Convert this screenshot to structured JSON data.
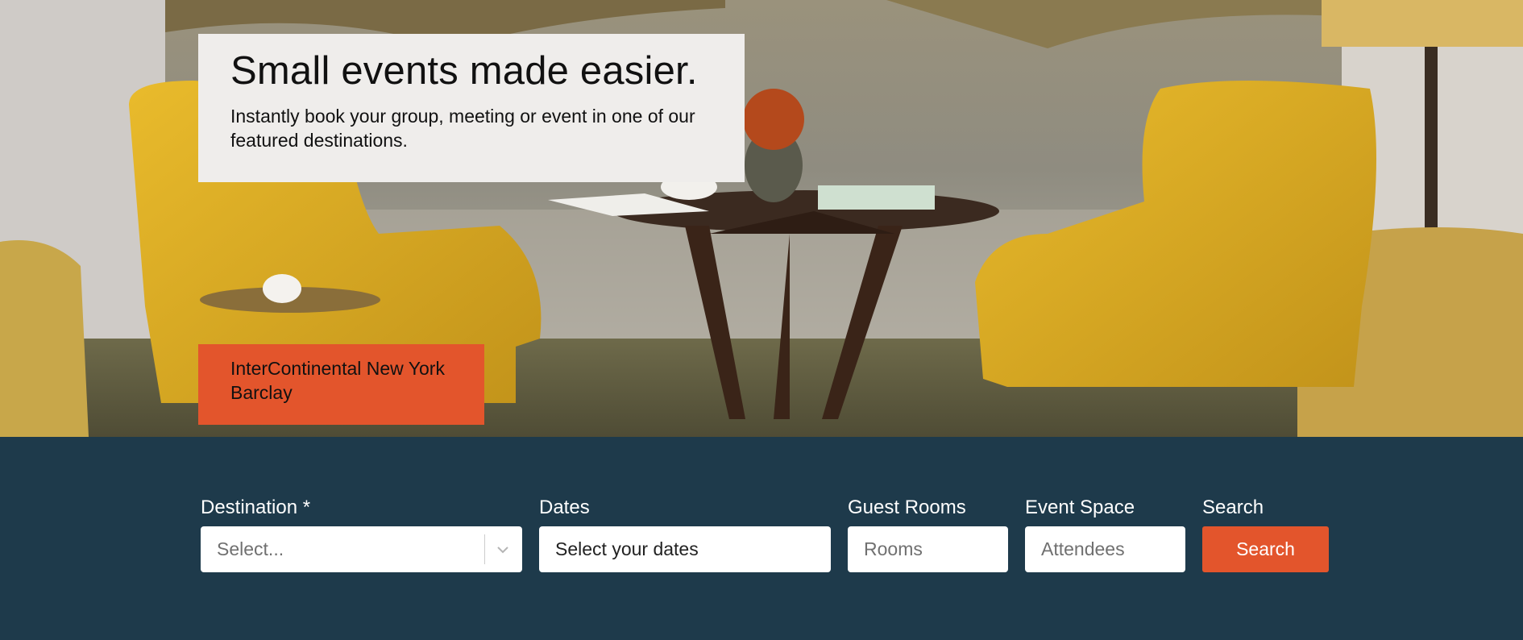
{
  "hero": {
    "headline": "Small events made easier.",
    "subheadline": "Instantly book your group, meeting or event in one of our featured destinations.",
    "hotel_name": "InterContinental New York Barclay"
  },
  "search": {
    "destination": {
      "label": "Destination *",
      "placeholder": "Select..."
    },
    "dates": {
      "label": "Dates",
      "value": "Select your dates"
    },
    "guest_rooms": {
      "label": "Guest Rooms",
      "placeholder": "Rooms"
    },
    "event_space": {
      "label": "Event Space",
      "placeholder": "Attendees"
    },
    "submit": {
      "label": "Search",
      "button_label": "Search"
    }
  },
  "colors": {
    "accent": "#e3552c",
    "search_bar_bg": "#1e3a4b",
    "card_bg": "#efedeb"
  },
  "icons": {
    "destination_dropdown": "chevron-down-icon"
  }
}
